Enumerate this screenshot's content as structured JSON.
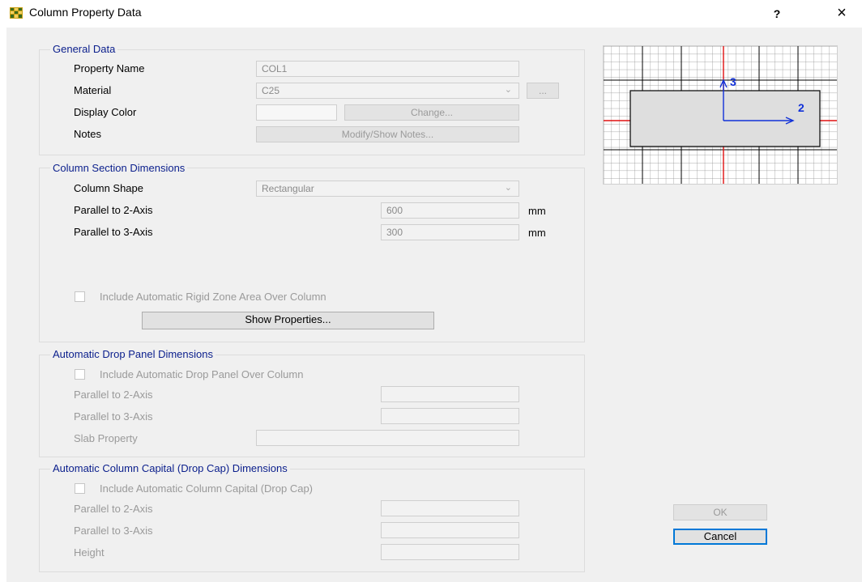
{
  "window": {
    "title": "Column Property Data",
    "help_label": "?",
    "close_label": "×"
  },
  "general_data": {
    "legend": "General Data",
    "property_name_label": "Property Name",
    "property_name_value": "COL1",
    "material_label": "Material",
    "material_value": "C25",
    "material_browse_label": "...",
    "display_color_label": "Display Color",
    "change_button": "Change...",
    "notes_label": "Notes",
    "notes_button": "Modify/Show Notes..."
  },
  "section_dimensions": {
    "legend": "Column Section Dimensions",
    "shape_label": "Column Shape",
    "shape_value": "Rectangular",
    "parallel2_label": "Parallel to 2-Axis",
    "parallel2_value": "600",
    "parallel2_unit": "mm",
    "parallel3_label": "Parallel to 3-Axis",
    "parallel3_value": "300",
    "parallel3_unit": "mm",
    "rigid_zone_label": "Include Automatic Rigid Zone Area Over Column",
    "show_properties_button": "Show Properties..."
  },
  "drop_panel": {
    "legend": "Automatic Drop Panel Dimensions",
    "include_label": "Include Automatic Drop Panel Over Column",
    "parallel2_label": "Parallel to 2-Axis",
    "parallel3_label": "Parallel to 3-Axis",
    "slab_property_label": "Slab Property"
  },
  "column_capital": {
    "legend": "Automatic Column Capital (Drop Cap) Dimensions",
    "include_label": "Include Automatic Column Capital (Drop Cap)",
    "parallel2_label": "Parallel to 2-Axis",
    "parallel3_label": "Parallel to 3-Axis",
    "height_label": "Height"
  },
  "preview": {
    "axis2_label": "2",
    "axis3_label": "3"
  },
  "actions": {
    "ok_label": "OK",
    "cancel_label": "Cancel"
  },
  "colors": {
    "legend_text": "#0a1e8c",
    "axis_blue": "#1030d8",
    "axis_red": "#e01010",
    "focus_border": "#0078d7"
  },
  "icons": {
    "app": "grid-app-icon",
    "help": "help-icon",
    "close": "close-icon",
    "dropdown": "chevron-down-icon"
  }
}
